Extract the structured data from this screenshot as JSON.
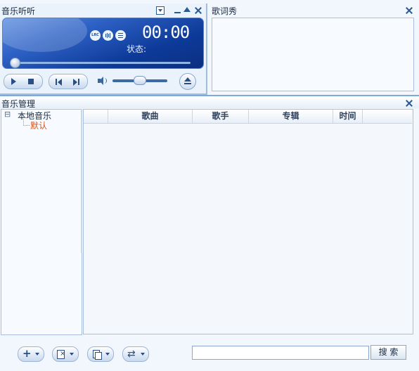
{
  "player": {
    "title": "音乐听听",
    "time": "00:00",
    "status_label": "状态:",
    "lrc_icon": "LRC",
    "wave_icon": "wave-icon",
    "list_icon": "list-icon"
  },
  "lyrics": {
    "title": "歌词秀"
  },
  "manager": {
    "title": "音乐管理",
    "tree": {
      "root_label": "本地音乐",
      "child_label": "默认",
      "expand_glyph": "⊟"
    },
    "columns": [
      "歌曲",
      "歌手",
      "专辑",
      "时间"
    ]
  },
  "bottom": {
    "search_placeholder": "",
    "search_label": "搜 索"
  },
  "colors": {
    "accent": "#1f4f9b",
    "child_text": "#d4561c",
    "background": "#f2f7fd"
  }
}
